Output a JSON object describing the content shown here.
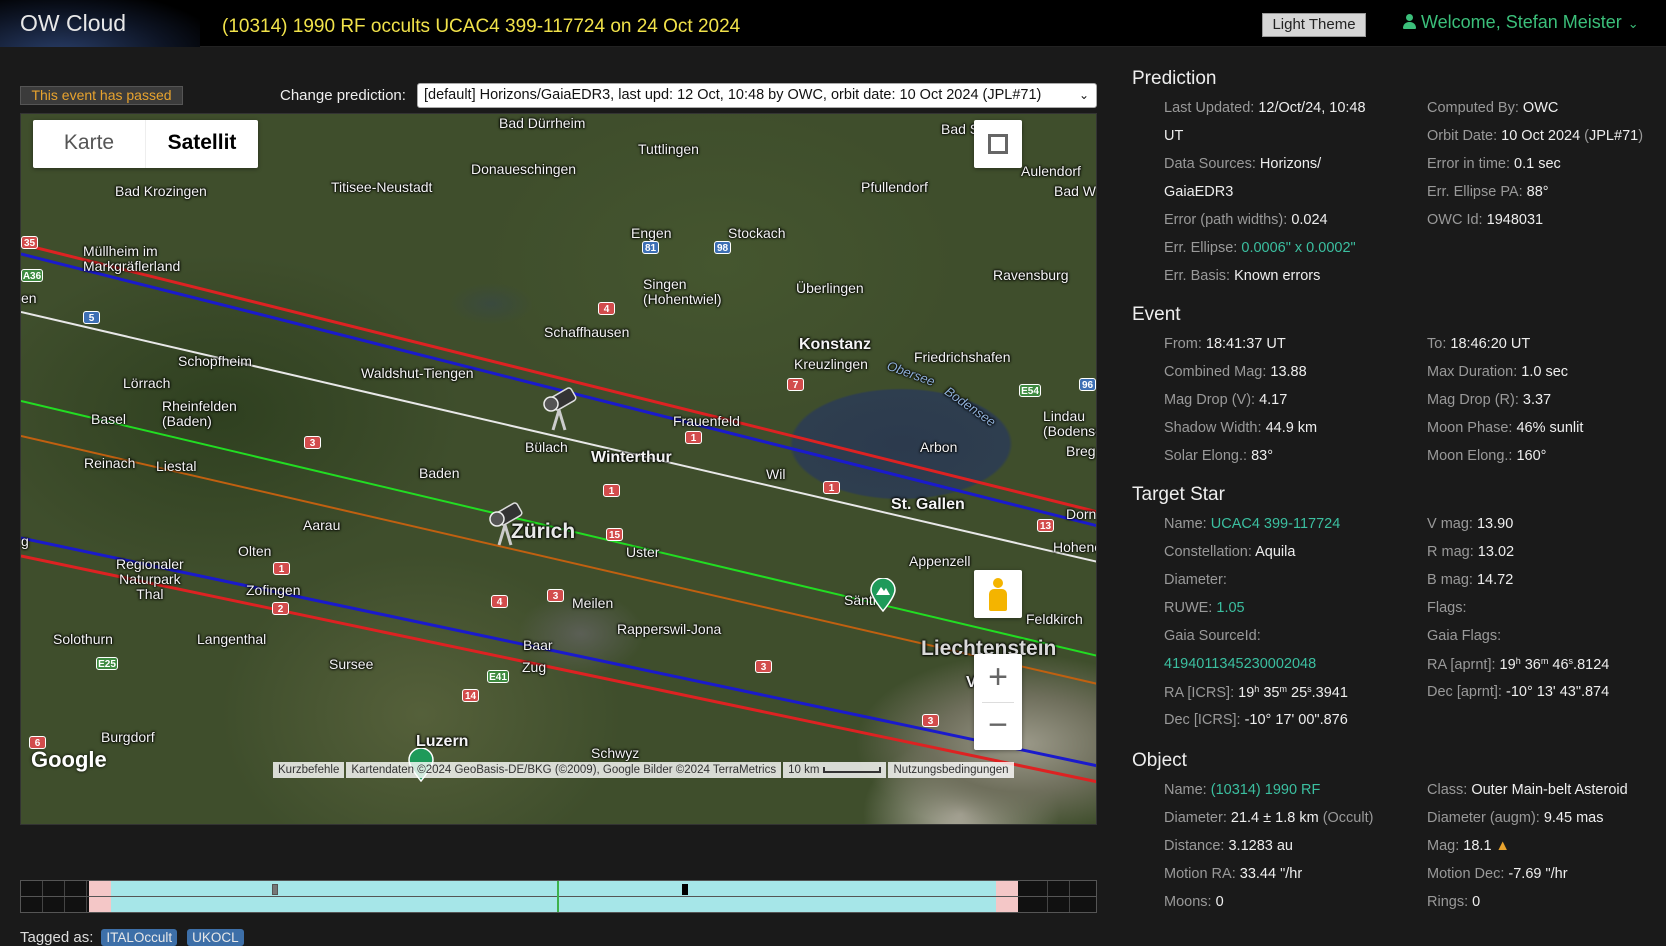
{
  "app": {
    "logo": "OW Cloud",
    "title": "(10314) 1990 RF occults UCAC4 399-117724 on 24 Oct 2024"
  },
  "header": {
    "theme_button": "Light Theme",
    "welcome": "Welcome, Stefan Meister"
  },
  "event_status": "This event has passed",
  "prediction_selector": {
    "label": "Change prediction:",
    "selected": "[default] Horizons/GaiaEDR3, last upd: 12 Oct, 10:48 by OWC, orbit date: 10 Oct 2024 (JPL#71)"
  },
  "map": {
    "type_buttons": [
      "Karte",
      "Satellit"
    ],
    "selected_type": "Satellit",
    "labels": {
      "bad_duerrheim": "Bad Dürrheim",
      "bad_saulgau": "Bad Saulgau",
      "tuttlingen": "Tuttlingen",
      "donaueschingen": "Donaueschingen",
      "aulendorf": "Aulendorf",
      "bad_krozingen": "Bad Krozingen",
      "titisee": "Titisee-Neustadt",
      "pfullendorf": "Pfullendorf",
      "bad_w": "Bad W",
      "engen": "Engen",
      "stockach": "Stockach",
      "muellheim": "Müllheim im\nMarkgräflerland",
      "singen": "Singen\n(Hohentwiel)",
      "ueberlingen": "Überlingen",
      "ravensburg": "Ravensburg",
      "schaffhausen": "Schaffhausen",
      "konstanz": "Konstanz",
      "kreuzlingen": "Kreuzlingen",
      "friedrichshafen": "Friedrichshafen",
      "schopfheim": "Schopfheim",
      "waldshut": "Waldshut-Tiengen",
      "obersee": "Obersee",
      "bodensee": "Bodensee",
      "loerrach": "Lörrach",
      "lindau": "Lindau\n(Bodense",
      "rheinfelden": "Rheinfelden\n(Baden)",
      "basel": "Basel",
      "frauenfeld": "Frauenfeld",
      "buelach": "Bülach",
      "arbon": "Arbon",
      "breg": "Breg",
      "reinach": "Reinach",
      "liestal": "Liestal",
      "winterthur": "Winterthur",
      "baden": "Baden",
      "wil": "Wil",
      "st_gallen": "St. Gallen",
      "dorn": "Dorn",
      "aarau": "Aarau",
      "zurich": "Zürich",
      "uster": "Uster",
      "hohenems": "Hohenem",
      "olten": "Olten",
      "appenzell": "Appenzell",
      "regionaler": "Regionaler\nNaturpark\nThal",
      "zofingen": "Zofingen",
      "meilen": "Meilen",
      "saentis": "Säntis",
      "feldkirch": "Feldkirch",
      "rapperswil": "Rapperswil-Jona",
      "solothurn": "Solothurn",
      "langenthal": "Langenthal",
      "liechtenstein": "Liechtenstein",
      "sursee": "Sursee",
      "zug": "Zug",
      "baar": "Baar",
      "vaduz": "Vaduz",
      "burgdorf": "Burgdorf",
      "luzern": "Luzern",
      "schwyz": "Schwyz",
      "en": "en",
      "g": "g"
    },
    "google": "Google",
    "attribution": [
      "Kurzbefehle",
      "Kartendaten ©2024 GeoBasis-DE/BKG (©2009), Google Bilder ©2024 TerraMetrics",
      "10 km",
      "Nutzungsbedingungen"
    ]
  },
  "tags": {
    "label": "Tagged as:",
    "items": [
      "ITALOccult",
      "UKOCL"
    ]
  },
  "prediction": {
    "heading": "Prediction",
    "last_updated_label": "Last Updated:",
    "last_updated": "12/Oct/24, 10:48",
    "last_updated_ut": "UT",
    "computed_by_label": "Computed By:",
    "computed_by": "OWC",
    "orbit_date_label": "Orbit Date:",
    "orbit_date": "10 Oct 2024",
    "orbit_src_open": "(",
    "orbit_src": "JPL#71",
    "orbit_src_close": ")",
    "data_sources_label": "Data Sources:",
    "data_sources_1": "Horizons/",
    "data_sources_2": "GaiaEDR3",
    "error_time_label": "Error in time:",
    "error_time": "0.1 sec",
    "ellipse_pa_label": "Err. Ellipse PA:",
    "ellipse_pa": "88°",
    "path_widths_label": "Error (path widths):",
    "path_widths": "0.024",
    "owc_id_label": "OWC Id:",
    "owc_id": "1948031",
    "err_ellipse_label": "Err. Ellipse:",
    "err_ellipse": "0.0006\" x 0.0002\"",
    "err_basis_label": "Err. Basis:",
    "err_basis": "Known errors"
  },
  "event": {
    "heading": "Event",
    "from_label": "From:",
    "from": "18:41:37 UT",
    "to_label": "To:",
    "to": "18:46:20 UT",
    "combined_mag_label": "Combined Mag:",
    "combined_mag": "13.88",
    "max_duration_label": "Max Duration:",
    "max_duration": "1.0 sec",
    "mag_drop_v_label": "Mag Drop (V):",
    "mag_drop_v": "4.17",
    "mag_drop_r_label": "Mag Drop (R):",
    "mag_drop_r": "3.37",
    "shadow_width_label": "Shadow Width:",
    "shadow_width": "44.9 km",
    "moon_phase_label": "Moon Phase:",
    "moon_phase": "46% sunlit",
    "solar_elong_label": "Solar Elong.:",
    "solar_elong": "83°",
    "moon_elong_label": "Moon Elong.:",
    "moon_elong": "160°"
  },
  "target_star": {
    "heading": "Target Star",
    "name_label": "Name:",
    "name": "UCAC4 399-117724",
    "vmag_label": "V mag:",
    "vmag": "13.90",
    "constellation_label": "Constellation:",
    "constellation": "Aquila",
    "rmag_label": "R mag:",
    "rmag": "13.02",
    "diameter_label": "Diameter:",
    "bmag_label": "B mag:",
    "bmag": "14.72",
    "ruwe_label": "RUWE:",
    "ruwe": "1.05",
    "flags_label": "Flags:",
    "gaia_id_label": "Gaia SourceId:",
    "gaia_id": "4194011345230002048",
    "gaia_flags_label": "Gaia Flags:",
    "ra_aprnt_label": "RA [aprnt]:",
    "ra_aprnt_h": "19",
    "ra_aprnt_m": "36",
    "ra_aprnt_s": "46",
    "ra_aprnt_frac": ".8124",
    "ra_icrs_label": "RA [ICRS]:",
    "ra_icrs_h": "19",
    "ra_icrs_m": "35",
    "ra_icrs_s": "25",
    "ra_icrs_frac": ".3941",
    "dec_aprnt_label": "Dec [aprnt]:",
    "dec_aprnt": "-10° 13' 43\".874",
    "dec_icrs_label": "Dec [ICRS]:",
    "dec_icrs": "-10° 17' 00\".876"
  },
  "object": {
    "heading": "Object",
    "name_label": "Name:",
    "name": "(10314) 1990 RF",
    "class_label": "Class:",
    "class": "Outer Main-belt Asteroid",
    "diameter_label": "Diameter:",
    "diameter": "21.4 ± 1.8 km",
    "diameter_src": "(Occult)",
    "diameter_augm_label": "Diameter (augm):",
    "diameter_augm": "9.45 mas",
    "distance_label": "Distance:",
    "distance": "3.1283 au",
    "mag_label": "Mag:",
    "mag": "18.1",
    "motion_ra_label": "Motion RA:",
    "motion_ra": "33.44 \"/hr",
    "motion_dec_label": "Motion Dec:",
    "motion_dec": "-7.69 \"/hr",
    "moons_label": "Moons:",
    "moons": "0",
    "rings_label": "Rings:",
    "rings": "0"
  },
  "colors": {
    "title": "#f1e24a",
    "welcome": "#3bbf7a",
    "link": "#3bbfa0",
    "passed": "#e8a32e",
    "centerline": "#22dd22",
    "path_limit": "#1a1acc",
    "error_limit": "#dd2222",
    "sigma": "#c06010",
    "asteroid_path": "#e8e8e8"
  }
}
